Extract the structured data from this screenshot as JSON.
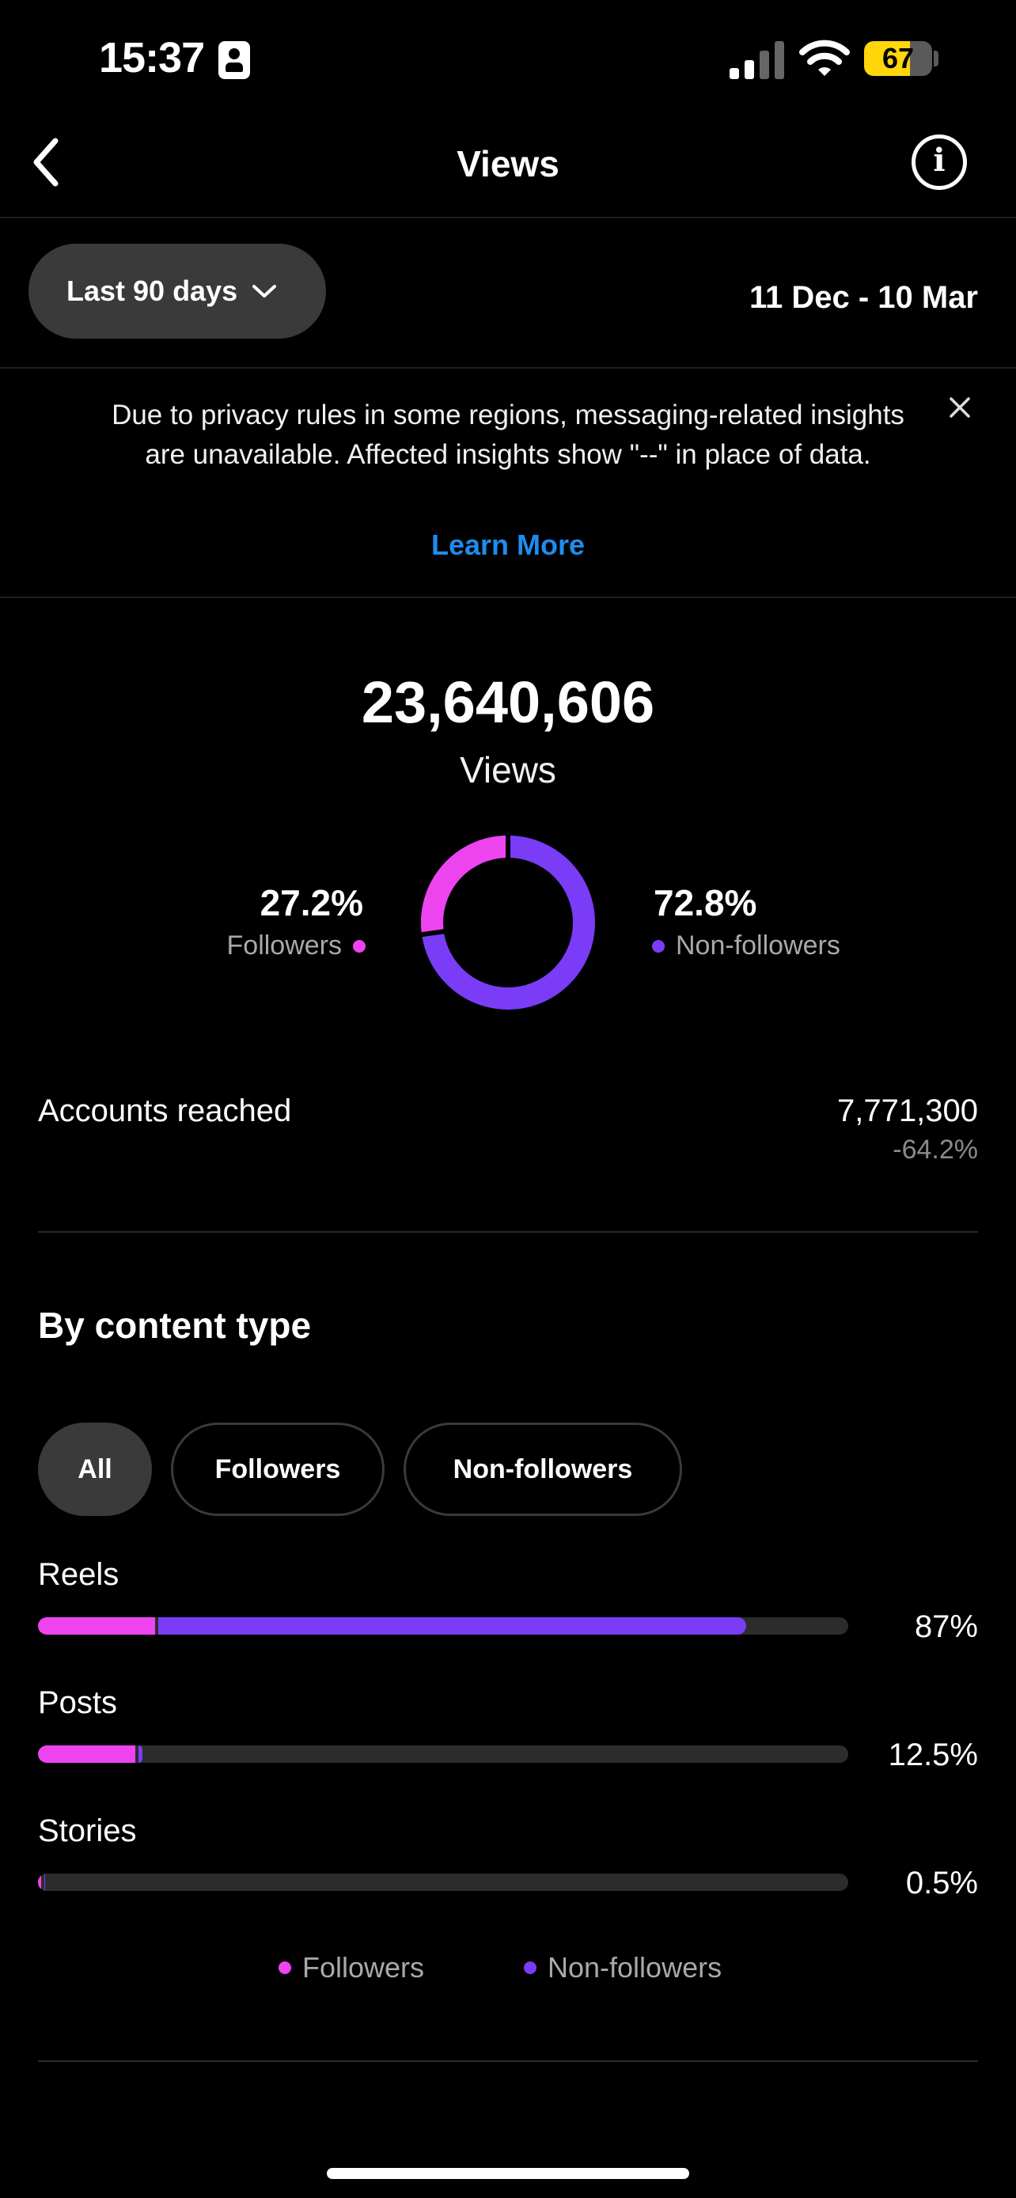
{
  "status_bar": {
    "time": "15:37",
    "battery": "67",
    "battery_level": 0.67
  },
  "header": {
    "title": "Views"
  },
  "range": {
    "selected": "Last 90 days",
    "dates": "11 Dec - 10 Mar"
  },
  "notice": {
    "text": "Due to privacy rules in some regions, messaging-related insights are unavailable. Affected insights show \"--\" in place of data.",
    "link": "Learn More"
  },
  "summary": {
    "total": "23,640,606",
    "label": "Views",
    "followers_pct": "27.2%",
    "followers_label": "Followers",
    "nonfollowers_pct": "72.8%",
    "nonfollowers_label": "Non-followers",
    "followers_fraction": 0.272
  },
  "accounts": {
    "label": "Accounts reached",
    "value": "7,771,300",
    "change": "-64.2%"
  },
  "content_type": {
    "title": "By content type",
    "chips": [
      "All",
      "Followers",
      "Non-followers"
    ],
    "active_chip": "All",
    "rows": [
      {
        "label": "Reels",
        "value": "87%",
        "followers_fraction": 0.145,
        "nonfollowers_fraction": 0.725
      },
      {
        "label": "Posts",
        "value": "12.5%",
        "followers_fraction": 0.12,
        "nonfollowers_fraction": 0.005
      },
      {
        "label": "Stories",
        "value": "0.5%",
        "followers_fraction": 0.004,
        "nonfollowers_fraction": 0.001
      }
    ],
    "legend": [
      "Followers",
      "Non-followers"
    ]
  },
  "colors": {
    "followers": "#ee44f0",
    "nonfollowers": "#7a3cf6",
    "link": "#1e8cf0"
  }
}
